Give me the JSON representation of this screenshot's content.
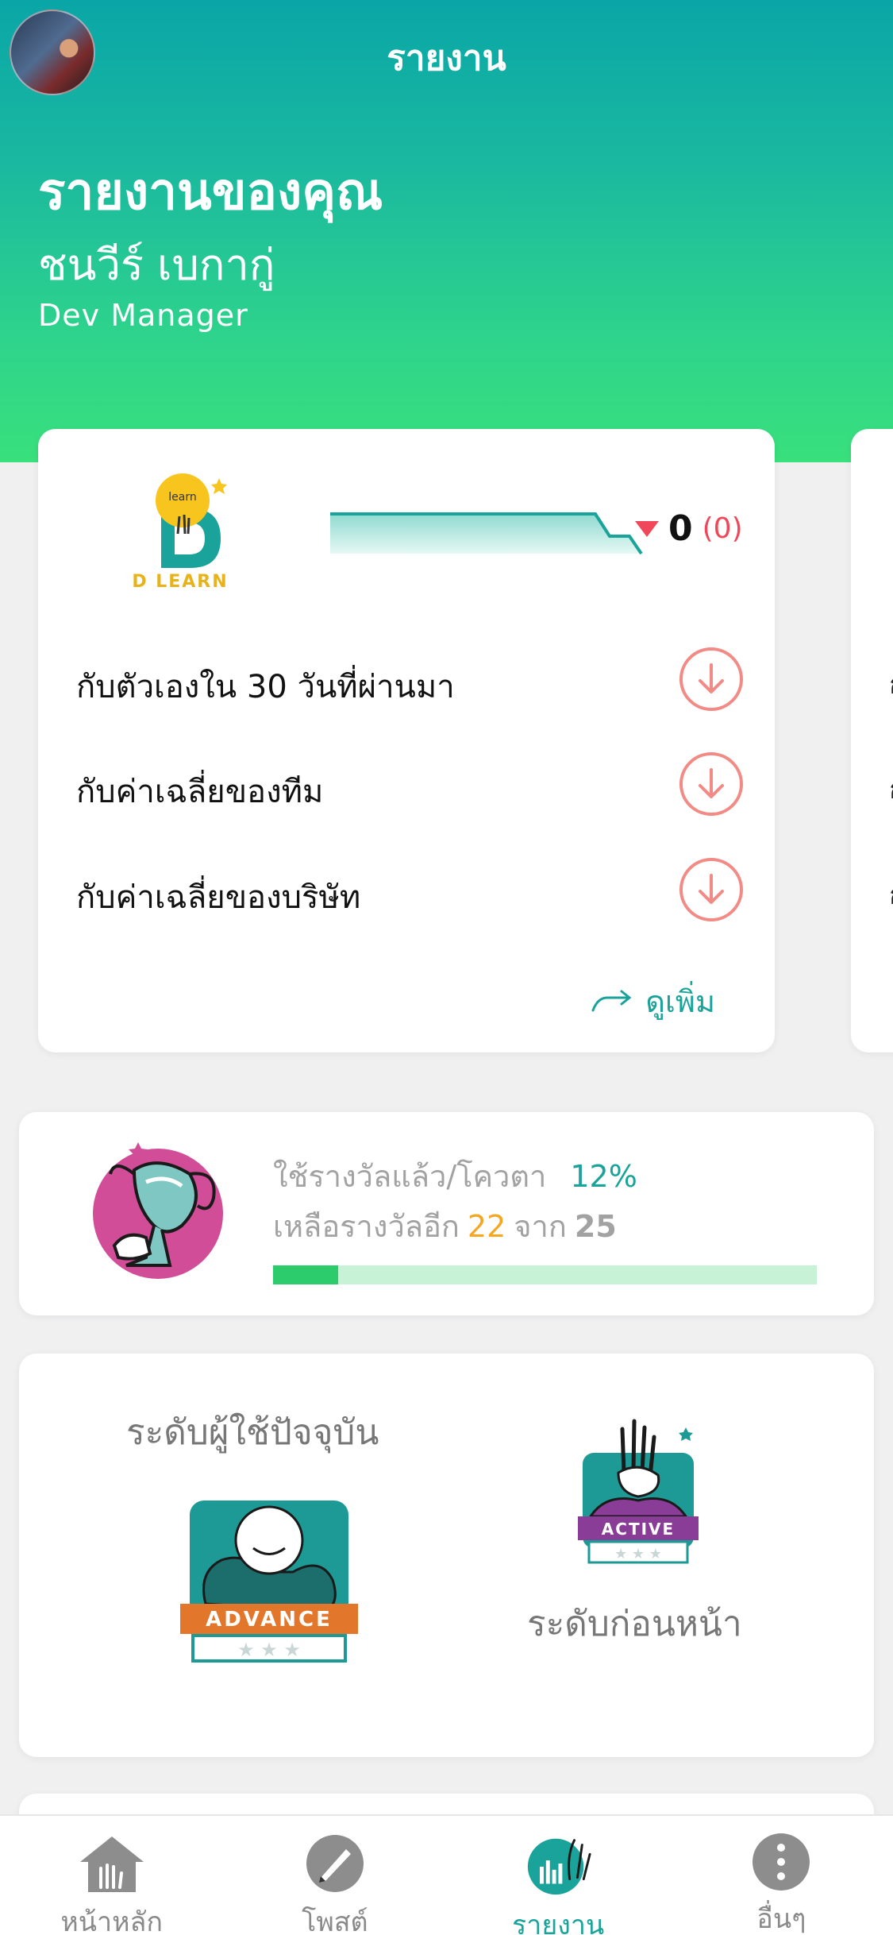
{
  "header": {
    "title": "รายงาน",
    "report_title": "รายงานของคุณ",
    "user_name": "ชนวีร์ เบกากู่",
    "user_role": "Dev Manager"
  },
  "dlearn_card": {
    "logo_text": "D LEARN",
    "logo_inner_text": "learn",
    "change_value": "0",
    "change_paren": "(0)",
    "trend": "down",
    "comparisons": [
      {
        "label": "กับตัวเองใน 30 วันที่ผ่านมา",
        "icon": "arrow-down-circle-icon"
      },
      {
        "label": "กับค่าเฉลี่ยของทีม",
        "icon": "arrow-down-circle-icon"
      },
      {
        "label": "กับค่าเฉลี่ยของบริษัท",
        "icon": "arrow-down-circle-icon"
      }
    ],
    "more_label": "ดูเพิ่ม",
    "peek_chars": [
      "ก",
      "ก",
      "ก"
    ]
  },
  "reward": {
    "used_label": "ใช้รางวัลแล้ว/โควตา",
    "used_percent": "12%",
    "used_fraction": 0.12,
    "remaining_prefix": "เหลือรางวัลอีก",
    "remaining": "22",
    "remaining_of": "จาก",
    "total": "25"
  },
  "level": {
    "current_label": "ระดับผู้ใช้ปัจจุบัน",
    "current_badge": "ADVANCE",
    "previous_label": "ระดับก่อนหน้า",
    "previous_badge": "ACTIVE"
  },
  "nav": {
    "items": [
      {
        "label": "หน้าหลัก",
        "icon": "home-hand-icon",
        "active": false
      },
      {
        "label": "โพสต์",
        "icon": "post-pen-icon",
        "active": false
      },
      {
        "label": "รายงาน",
        "icon": "report-chart-icon",
        "active": true
      },
      {
        "label": "อื่นๆ",
        "icon": "more-dots-icon",
        "active": false
      }
    ]
  },
  "colors": {
    "accent_teal": "#1aa39a",
    "header_top": "#0aa6a7",
    "header_bottom": "#39e07c",
    "down_red": "#f0475a",
    "orange": "#f5a623",
    "progress": "#2ccb6b"
  }
}
